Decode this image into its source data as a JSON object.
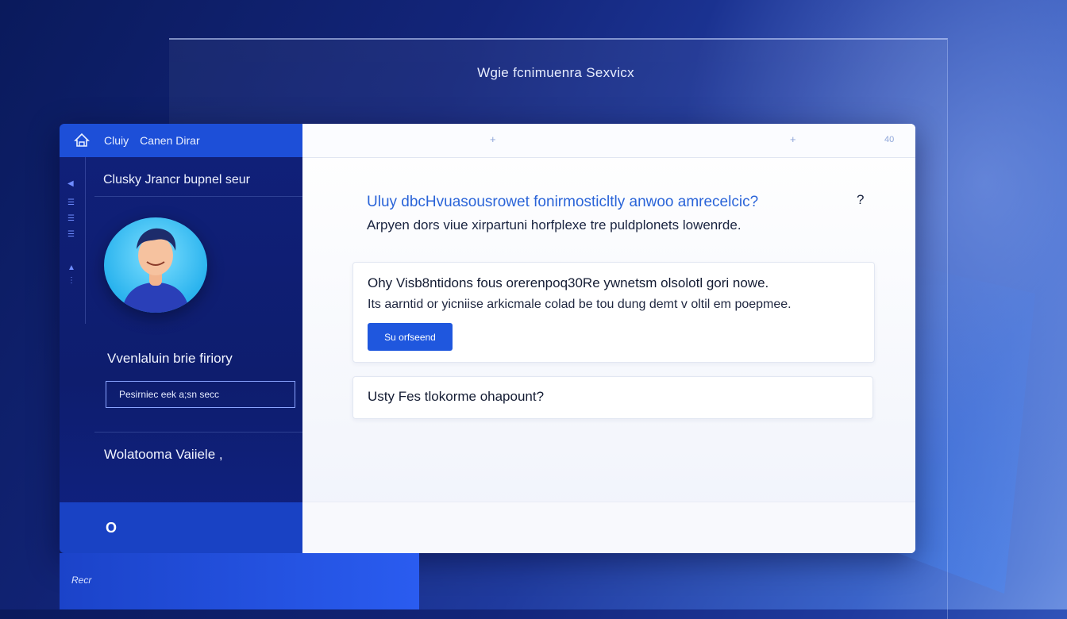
{
  "page": {
    "title": "Wgie fcnimuenra Sexvicx"
  },
  "sidebar": {
    "header_title_a": "Cluiy",
    "header_title_b": "Canen Dirar",
    "section_title": "Clusky Jrancr bupnel seur",
    "label_one": "Vvenlaluin brie firiory",
    "input_value": "Pesirniec eek a;sn secc",
    "label_two": "Wolatooma Vaiiele ,",
    "footer_icon": "O"
  },
  "main": {
    "topbar": {
      "item_one": "+",
      "item_two": "+",
      "item_three": "40"
    },
    "question": "Uluy dbcHvuasousrowet fonirmosticltly anwoo amrecelcic?",
    "question_mark": "?",
    "subtitle": "Arpyen dors viue xirpartuni horfplexe tre puldplonets lowenrde.",
    "card_one": {
      "title": "Ohy Visb8ntidons fous orerenpoq30Re ywnetsm olsolotl gori nowe.",
      "text": "Its aarntid or yicniise arkicmale  colad be tou dung demt v oltil em poepmee.",
      "button_label": "Su orfseend"
    },
    "card_two": {
      "title": "Usty Fes tlokorme ohapount?"
    }
  },
  "bottom_panel": {
    "label": "Recr"
  },
  "colors": {
    "accent": "#1f57de",
    "sidebar_bg": "#10207a",
    "header_bar": "#1d4fd8",
    "question_text": "#2a64d8"
  },
  "icons": {
    "logo": "home-icon",
    "footer": "circle-icon"
  }
}
